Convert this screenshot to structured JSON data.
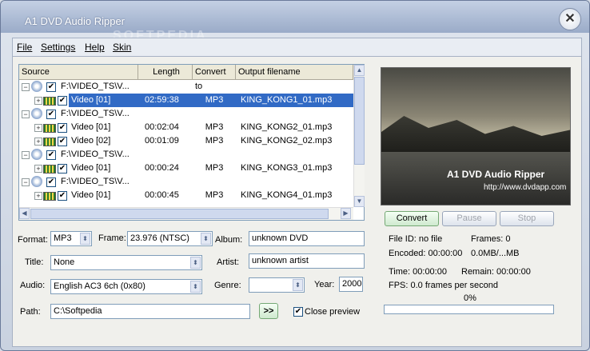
{
  "window": {
    "title": "A1 DVD Audio Ripper",
    "close_glyph": "✕",
    "watermark": "SOFTPEDIA"
  },
  "menu": [
    {
      "label": "File"
    },
    {
      "label": "Settings"
    },
    {
      "label": "Help"
    },
    {
      "label": "Skin"
    }
  ],
  "list": {
    "columns": [
      "Source",
      "Length",
      "Convert to",
      "Output filename"
    ],
    "rows": [
      {
        "kind": "disc",
        "name": "F:\\VIDEO_TS\\V...",
        "length": "",
        "convert": "",
        "output": ""
      },
      {
        "kind": "video",
        "name": "Video [01]",
        "length": "02:59:38",
        "convert": "MP3",
        "output": "KING_KONG1_01.mp3",
        "selected": true
      },
      {
        "kind": "disc",
        "name": "F:\\VIDEO_TS\\V...",
        "length": "",
        "convert": "",
        "output": ""
      },
      {
        "kind": "video",
        "name": "Video [01]",
        "length": "00:02:04",
        "convert": "MP3",
        "output": "KING_KONG2_01.mp3"
      },
      {
        "kind": "video",
        "name": "Video [02]",
        "length": "00:01:09",
        "convert": "MP3",
        "output": "KING_KONG2_02.mp3"
      },
      {
        "kind": "disc",
        "name": "F:\\VIDEO_TS\\V...",
        "length": "",
        "convert": "",
        "output": ""
      },
      {
        "kind": "video",
        "name": "Video [01]",
        "length": "00:00:24",
        "convert": "MP3",
        "output": "KING_KONG3_01.mp3"
      },
      {
        "kind": "disc",
        "name": "F:\\VIDEO_TS\\V...",
        "length": "",
        "convert": "",
        "output": ""
      },
      {
        "kind": "video",
        "name": "Video [01]",
        "length": "00:00:45",
        "convert": "MP3",
        "output": "KING_KONG4_01.mp3"
      }
    ]
  },
  "preview": {
    "title": "A1 DVD Audio Ripper",
    "url": "http://www.dvdapp.com"
  },
  "controls": {
    "convert": "Convert",
    "pause": "Pause",
    "stop": "Stop"
  },
  "form": {
    "format_label": "Format:",
    "format_value": "MP3",
    "frame_label": "Frame:",
    "frame_value": "23.976 (NTSC)",
    "title_label": "Title:",
    "title_value": "None",
    "audio_label": "Audio:",
    "audio_value": "English AC3 6ch (0x80)",
    "album_label": "Album:",
    "album_value": "unknown DVD",
    "artist_label": "Artist:",
    "artist_value": "unknown artist",
    "genre_label": "Genre:",
    "genre_value": "",
    "year_label": "Year:",
    "year_value": "2000",
    "path_label": "Path:",
    "path_value": "C:\\Softpedia",
    "browse_label": ">>",
    "close_preview_label": "Close preview",
    "close_preview_checked": true
  },
  "status": {
    "file_id": "File ID: no file",
    "frames": "Frames:   0",
    "encoded": "Encoded:  00:00:00",
    "size": "0.0MB/...MB",
    "time": "Time:   00:00:00",
    "remain": "Remain:    00:00:00",
    "fps": "FPS:   0.0 frames per second",
    "percent_label": "0%",
    "progress": 0
  }
}
